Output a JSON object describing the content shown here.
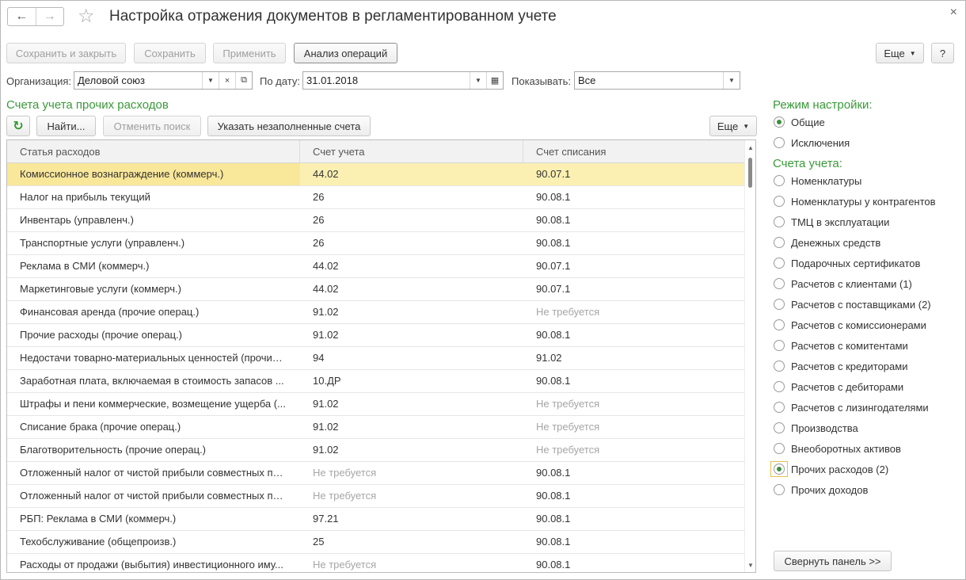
{
  "window": {
    "title": "Настройка отражения документов в регламентированном учете",
    "nav_back": "←",
    "nav_forward": "→",
    "star": "☆",
    "close": "×"
  },
  "toolbar": {
    "save_close": "Сохранить и закрыть",
    "save": "Сохранить",
    "apply": "Применить",
    "analysis": "Анализ операций",
    "more": "Еще",
    "help": "?"
  },
  "filters": {
    "org_label": "Организация:",
    "org_value": "Деловой союз",
    "date_label": "По дату:",
    "date_value": "31.01.2018",
    "show_label": "Показывать:",
    "show_value": "Все"
  },
  "section_title": "Счета учета прочих расходов",
  "table_toolbar": {
    "find": "Найти...",
    "cancel_search": "Отменить поиск",
    "unfilled": "Указать незаполненные счета",
    "more": "Еще"
  },
  "table": {
    "columns": [
      "Статья расходов",
      "Счет учета",
      "Счет списания"
    ],
    "rows": [
      [
        "Комиссионное вознаграждение (коммерч.)",
        "44.02",
        "90.07.1"
      ],
      [
        "Налог на прибыль текущий",
        "26",
        "90.08.1"
      ],
      [
        "Инвентарь (управленч.)",
        "26",
        "90.08.1"
      ],
      [
        "Транспортные услуги (управленч.)",
        "26",
        "90.08.1"
      ],
      [
        "Реклама в СМИ (коммерч.)",
        "44.02",
        "90.07.1"
      ],
      [
        "Маркетинговые услуги (коммерч.)",
        "44.02",
        "90.07.1"
      ],
      [
        "Финансовая аренда (прочие операц.)",
        "91.02",
        "Не требуется"
      ],
      [
        "Прочие расходы (прочие операц.)",
        "91.02",
        "90.08.1"
      ],
      [
        "Недостачи товарно-материальных ценностей (прочие ...",
        "94",
        "91.02"
      ],
      [
        "Заработная плата, включаемая в стоимость запасов ...",
        "10.ДР",
        "90.08.1"
      ],
      [
        "Штрафы и пени коммерческие, возмещение ущерба (...",
        "91.02",
        "Не требуется"
      ],
      [
        "Списание брака (прочие операц.)",
        "91.02",
        "Не требуется"
      ],
      [
        "Благотворительность (прочие операц.)",
        "91.02",
        "Не требуется"
      ],
      [
        "Отложенный налог от чистой прибыли совместных пр...",
        "Не требуется",
        "90.08.1"
      ],
      [
        "Отложенный налог от чистой прибыли совместных пр...",
        "Не требуется",
        "90.08.1"
      ],
      [
        "РБП: Реклама в СМИ (коммерч.)",
        "97.21",
        "90.08.1"
      ],
      [
        "Техобслуживание (общепроизв.)",
        "25",
        "90.08.1"
      ],
      [
        "Расходы от продажи (выбытия) инвестиционного иму...",
        "Не требуется",
        "90.08.1"
      ]
    ]
  },
  "panel": {
    "mode_title": "Режим настройки:",
    "modes": [
      {
        "label": "Общие",
        "selected": true
      },
      {
        "label": "Исключения",
        "selected": false
      }
    ],
    "accounts_title": "Счета учета:",
    "accounts": [
      {
        "label": "Номенклатуры",
        "selected": false
      },
      {
        "label": "Номенклатуры у контрагентов",
        "selected": false
      },
      {
        "label": "ТМЦ в эксплуатации",
        "selected": false
      },
      {
        "label": "Денежных средств",
        "selected": false
      },
      {
        "label": "Подарочных сертификатов",
        "selected": false
      },
      {
        "label": "Расчетов с клиентами (1)",
        "selected": false
      },
      {
        "label": "Расчетов с поставщиками (2)",
        "selected": false
      },
      {
        "label": "Расчетов с комиссионерами",
        "selected": false
      },
      {
        "label": "Расчетов с комитентами",
        "selected": false
      },
      {
        "label": "Расчетов с кредиторами",
        "selected": false
      },
      {
        "label": "Расчетов с дебиторами",
        "selected": false
      },
      {
        "label": "Расчетов с лизингодателями",
        "selected": false
      },
      {
        "label": "Производства",
        "selected": false
      },
      {
        "label": "Внеоборотных активов",
        "selected": false
      },
      {
        "label": "Прочих расходов (2)",
        "selected": true
      },
      {
        "label": "Прочих доходов",
        "selected": false
      }
    ],
    "collapse": "Свернуть панель >>"
  },
  "colors": {
    "accent_green": "#3a9a3a",
    "selected_row": "#fbf0b2"
  }
}
